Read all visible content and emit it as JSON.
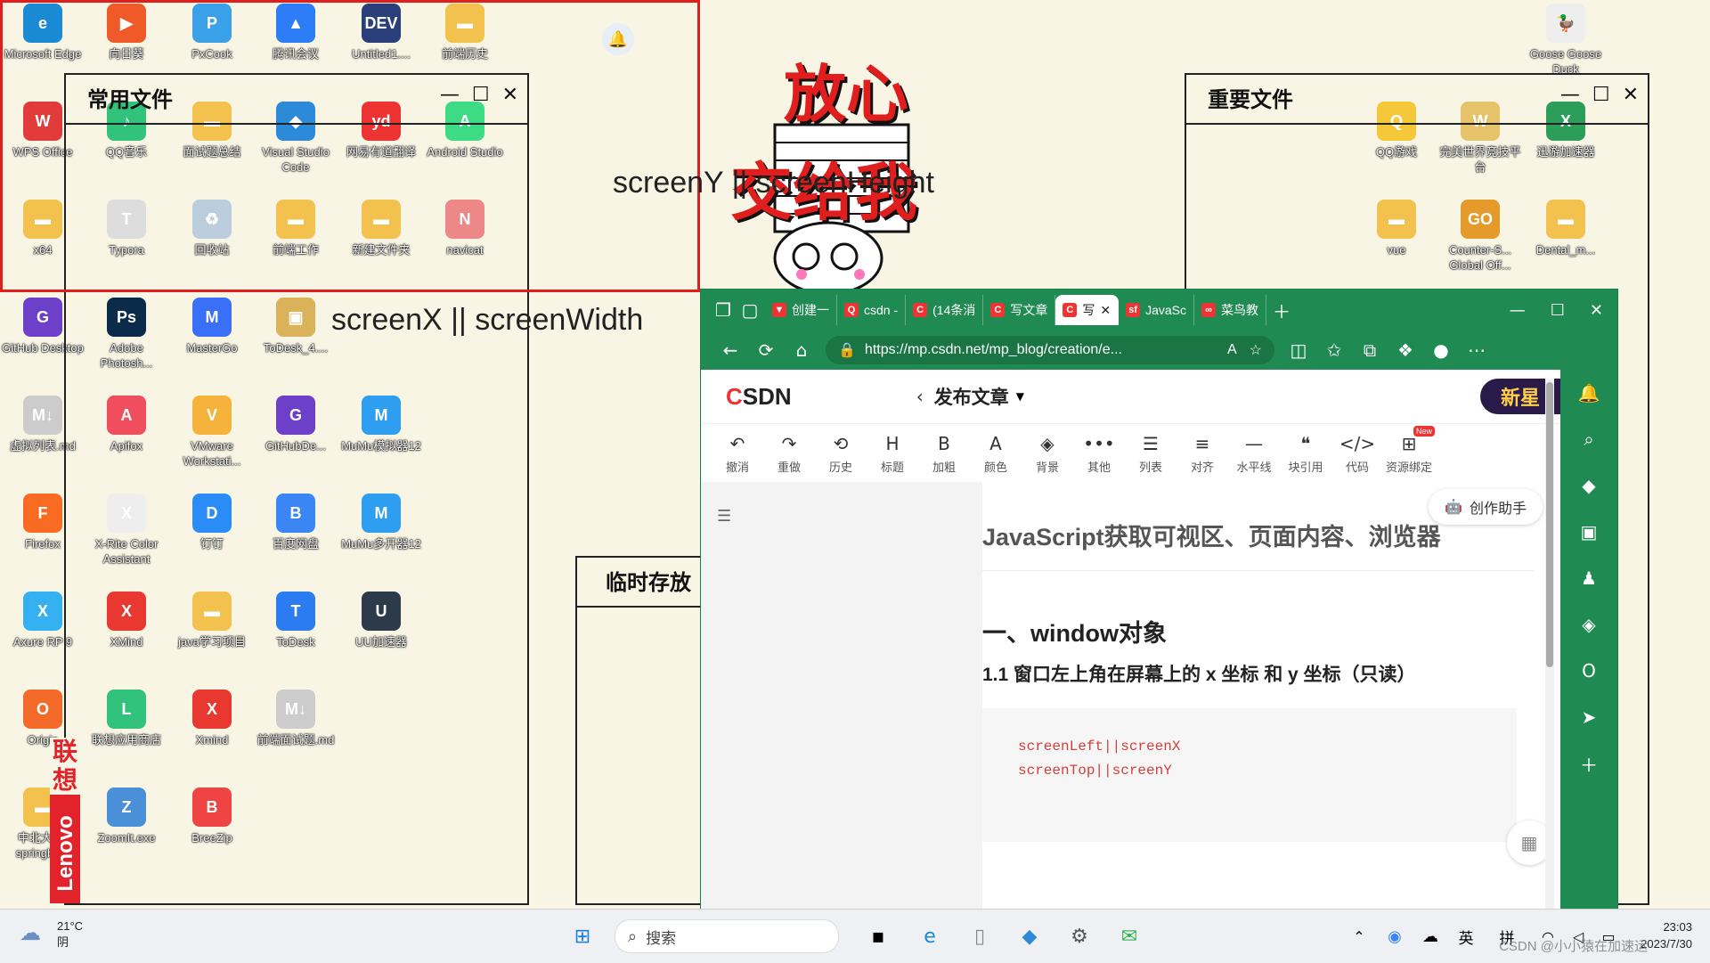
{
  "desktop": {
    "icons": [
      {
        "label": "Microsoft Edge",
        "glyph": "e",
        "color": "#1a8ad4"
      },
      {
        "label": "向日葵",
        "glyph": "▶",
        "color": "#f05a28"
      },
      {
        "label": "PxCook",
        "glyph": "P",
        "color": "#3aa0e8"
      },
      {
        "label": "腾讯会议",
        "glyph": "▲",
        "color": "#2d7df6"
      },
      {
        "label": "Untitled1....",
        "glyph": "DEV",
        "color": "#2a3f7a"
      },
      {
        "label": "前端历史",
        "glyph": "▬",
        "color": "#f2c14e"
      },
      {
        "label": "WPS Office",
        "glyph": "W",
        "color": "#e23b3b"
      },
      {
        "label": "QQ音乐",
        "glyph": "♪",
        "color": "#31c27c"
      },
      {
        "label": "面试题总结",
        "glyph": "▬",
        "color": "#f2c14e"
      },
      {
        "label": "Visual Studio Code",
        "glyph": "◆",
        "color": "#2c8ad8"
      },
      {
        "label": "网易有道翻译",
        "glyph": "yd",
        "color": "#e33"
      },
      {
        "label": "Android Studio",
        "glyph": "A",
        "color": "#3ddc84"
      },
      {
        "label": "x64",
        "glyph": "▬",
        "color": "#f2c14e"
      },
      {
        "label": "Typora",
        "glyph": "T",
        "color": "#ddd"
      },
      {
        "label": "回收站",
        "glyph": "♻",
        "color": "#bcd"
      },
      {
        "label": "前端工作",
        "glyph": "▬",
        "color": "#f2c14e"
      },
      {
        "label": "新建文件夹",
        "glyph": "▬",
        "color": "#f2c14e"
      },
      {
        "label": "navicat",
        "glyph": "N",
        "color": "#e88"
      },
      {
        "label": "GitHub Desktop",
        "glyph": "G",
        "color": "#6e40c9"
      },
      {
        "label": "Adobe Photosh...",
        "glyph": "Ps",
        "color": "#0a2b4a"
      },
      {
        "label": "MasterGo",
        "glyph": "M",
        "color": "#3a6ff7"
      },
      {
        "label": "ToDesk_4....",
        "glyph": "▣",
        "color": "#d9b25a"
      },
      {
        "label": "虚拟列表.md",
        "glyph": "M↓",
        "color": "#ccc"
      },
      {
        "label": "Apifox",
        "glyph": "A",
        "color": "#f04e5e"
      },
      {
        "label": "VMware Workstati...",
        "glyph": "V",
        "color": "#f6b33b"
      },
      {
        "label": "GitHubDe...",
        "glyph": "G",
        "color": "#6e40c9"
      },
      {
        "label": "MuMu模拟器12",
        "glyph": "M",
        "color": "#2d9ef0"
      },
      {
        "label": "Firefox",
        "glyph": "F",
        "color": "#f96b22"
      },
      {
        "label": "X-Rite Color Assistant",
        "glyph": "X",
        "color": "#eee"
      },
      {
        "label": "钉钉",
        "glyph": "D",
        "color": "#2a8cf6"
      },
      {
        "label": "百度网盘",
        "glyph": "B",
        "color": "#3a86f5"
      },
      {
        "label": "MuMu多开器12",
        "glyph": "M",
        "color": "#2d9ef0"
      },
      {
        "label": "Axure RP 9",
        "glyph": "X",
        "color": "#35b0f0"
      },
      {
        "label": "XMind",
        "glyph": "X",
        "color": "#e8382f"
      },
      {
        "label": "java学习项目",
        "glyph": "▬",
        "color": "#f2c14e"
      },
      {
        "label": "ToDesk",
        "glyph": "T",
        "color": "#2b7cf0"
      },
      {
        "label": "UU加速器",
        "glyph": "U",
        "color": "#2c3a4a"
      },
      {
        "label": "Origin",
        "glyph": "O",
        "color": "#f46a2a"
      },
      {
        "label": "联想应用商店",
        "glyph": "L",
        "color": "#31c27c"
      },
      {
        "label": "Xmind",
        "glyph": "X",
        "color": "#e8382f"
      },
      {
        "label": "前端面试题.md",
        "glyph": "M↓",
        "color": "#ccc"
      },
      {
        "label": "中北大学-springbo...",
        "glyph": "▬",
        "color": "#f2c14e"
      },
      {
        "label": "ZoomIt.exe",
        "glyph": "Z",
        "color": "#4a90d9"
      },
      {
        "label": "BreeZip",
        "glyph": "B",
        "color": "#e44"
      }
    ],
    "right_icons": [
      {
        "label": "Goose Goose Duck",
        "glyph": "🦆",
        "color": "#eee"
      },
      {
        "label": "QQ游戏",
        "glyph": "Q",
        "color": "#f5c83a"
      },
      {
        "label": "完美世界竞技平台",
        "glyph": "W",
        "color": "#e6c36b"
      },
      {
        "label": "迅游加速器",
        "glyph": "X",
        "color": "#2d9e5a"
      },
      {
        "label": "vue",
        "glyph": "▬",
        "color": "#f2c14e"
      },
      {
        "label": "Counter-S... Global Off...",
        "glyph": "GO",
        "color": "#e59b2b"
      },
      {
        "label": "Dental_m...",
        "glyph": "▬",
        "color": "#f2c14e"
      }
    ]
  },
  "fences": {
    "common": {
      "title": "常用文件"
    },
    "important": {
      "title": "重要文件"
    },
    "temp": {
      "title": "临时存放"
    }
  },
  "overlay": {
    "screen_y": "screenY || screenHeight",
    "screen_x": "screenX || screenWidth",
    "sticker_line1": "放心",
    "sticker_line2": "交给我",
    "lenovo": "联想",
    "lenovo_brand": "Lenovo"
  },
  "browser": {
    "tabs": [
      {
        "label": "创建一",
        "fav": "▼"
      },
      {
        "label": "csdn -",
        "fav": "Q"
      },
      {
        "label": "(14条消",
        "fav": "C"
      },
      {
        "label": "写文章",
        "fav": "C"
      },
      {
        "label": "写",
        "fav": "C",
        "active": true
      },
      {
        "label": "JavaSc",
        "fav": "sf"
      },
      {
        "label": "菜鸟教",
        "fav": "∞"
      }
    ],
    "url": "https://mp.csdn.net/mp_blog/creation/e...",
    "csdn_logo_c": "C",
    "csdn_logo_rest": "SDN",
    "page_title": "发布文章",
    "badge": "新星",
    "toolbar": [
      {
        "g": "↶",
        "l": "撤消"
      },
      {
        "g": "↷",
        "l": "重做"
      },
      {
        "g": "⟲",
        "l": "历史"
      },
      {
        "g": "H",
        "l": "标题"
      },
      {
        "g": "B",
        "l": "加粗"
      },
      {
        "g": "A",
        "l": "颜色"
      },
      {
        "g": "◈",
        "l": "背景"
      },
      {
        "g": "•••",
        "l": "其他"
      },
      {
        "g": "☰",
        "l": "列表"
      },
      {
        "g": "≡",
        "l": "对齐"
      },
      {
        "g": "—",
        "l": "水平线"
      },
      {
        "g": "❝",
        "l": "块引用"
      },
      {
        "g": "</>",
        "l": "代码"
      },
      {
        "g": "⊞",
        "l": "资源绑定"
      }
    ],
    "new_tag": "New",
    "assistant": "创作助手",
    "article_title": "JavaScript获取可视区、页面内容、浏览器",
    "h1": "一、window对象",
    "h2": "1.1 窗口左上角在屏幕上的 x 坐标 和 y 坐标（只读）",
    "code": [
      "screenLeft||screenX",
      "screenTop||screenY"
    ]
  },
  "taskbar": {
    "weather_temp": "21°C",
    "weather_desc": "阴",
    "search_placeholder": "搜索",
    "ime_lang": "英",
    "ime_mode": "拼",
    "time": "23:03",
    "date": "2023/7/30",
    "watermark": "CSDN @小小猿在加速运"
  }
}
